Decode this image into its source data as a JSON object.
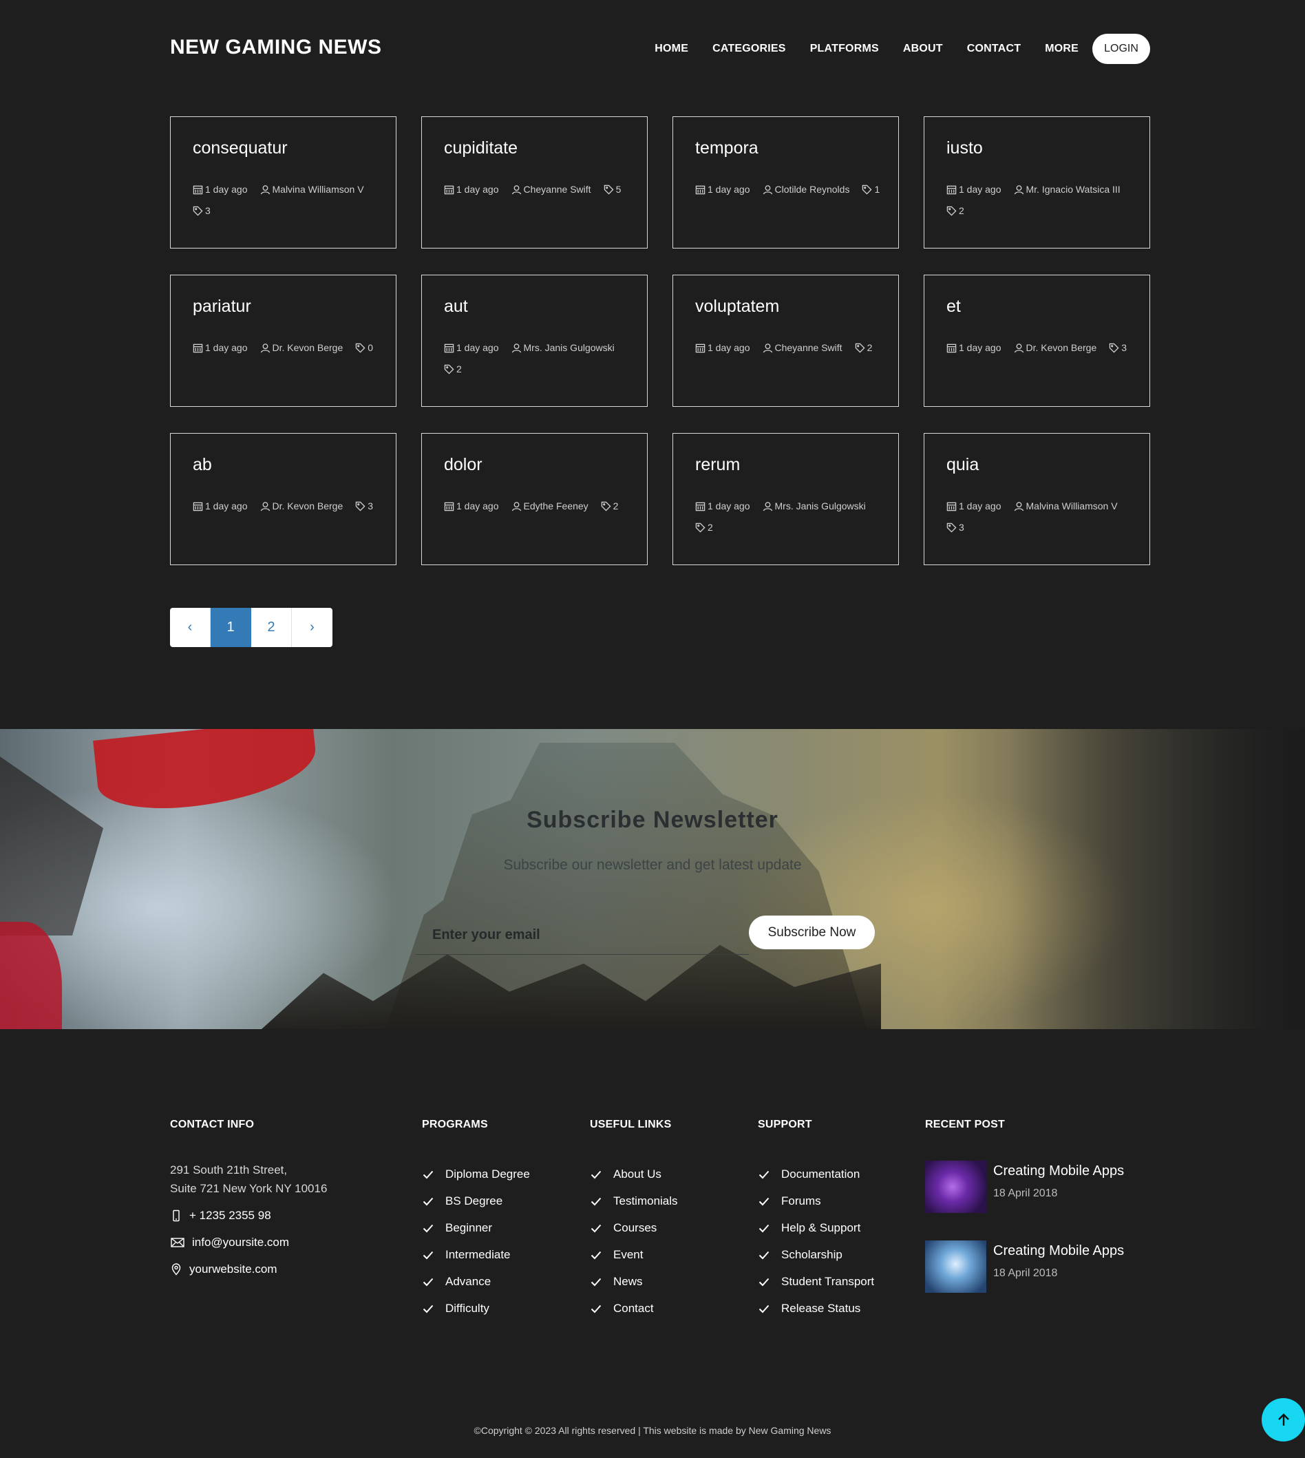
{
  "header": {
    "brand": "NEW GAMING NEWS",
    "nav": [
      "HOME",
      "CATEGORIES",
      "PLATFORMS",
      "ABOUT",
      "CONTACT",
      "MORE"
    ],
    "login": "LOGIN"
  },
  "posts": [
    {
      "title": "consequatur",
      "date": "1 day ago",
      "author": "Malvina Williamson V",
      "tags": "3"
    },
    {
      "title": "cupiditate",
      "date": "1 day ago",
      "author": "Cheyanne Swift",
      "tags": "5"
    },
    {
      "title": "tempora",
      "date": "1 day ago",
      "author": "Clotilde Reynolds",
      "tags": "1"
    },
    {
      "title": "iusto",
      "date": "1 day ago",
      "author": "Mr. Ignacio Watsica III",
      "tags": "2"
    },
    {
      "title": "pariatur",
      "date": "1 day ago",
      "author": "Dr. Kevon Berge",
      "tags": "0"
    },
    {
      "title": "aut",
      "date": "1 day ago",
      "author": "Mrs. Janis Gulgowski",
      "tags": "2"
    },
    {
      "title": "voluptatem",
      "date": "1 day ago",
      "author": "Cheyanne Swift",
      "tags": "2"
    },
    {
      "title": "et",
      "date": "1 day ago",
      "author": "Dr. Kevon Berge",
      "tags": "3"
    },
    {
      "title": "ab",
      "date": "1 day ago",
      "author": "Dr. Kevon Berge",
      "tags": "3"
    },
    {
      "title": "dolor",
      "date": "1 day ago",
      "author": "Edythe Feeney",
      "tags": "2"
    },
    {
      "title": "rerum",
      "date": "1 day ago",
      "author": "Mrs. Janis Gulgowski",
      "tags": "2"
    },
    {
      "title": "quia",
      "date": "1 day ago",
      "author": "Malvina Williamson V",
      "tags": "3"
    }
  ],
  "pagination": {
    "prev": "‹",
    "pages": [
      "1",
      "2"
    ],
    "active": "1",
    "next": "›"
  },
  "newsletter": {
    "title": "Subscribe Newsletter",
    "subtitle": "Subscribe our newsletter and get latest update",
    "placeholder": "Enter your email",
    "button": "Subscribe Now"
  },
  "footer": {
    "contact": {
      "heading": "CONTACT INFO",
      "address1": "291 South 21th Street,",
      "address2": "Suite 721 New York NY 10016",
      "phone": "+ 1235 2355 98",
      "email": "info@yoursite.com",
      "website": "yourwebsite.com"
    },
    "programs": {
      "heading": "PROGRAMS",
      "items": [
        "Diploma Degree",
        "BS Degree",
        "Beginner",
        "Intermediate",
        "Advance",
        "Difficulty"
      ]
    },
    "useful_links": {
      "heading": "USEFUL LINKS",
      "items": [
        "About Us",
        "Testimonials",
        "Courses",
        "Event",
        "News",
        "Contact"
      ]
    },
    "support": {
      "heading": "SUPPORT",
      "items": [
        "Documentation",
        "Forums",
        "Help & Support",
        "Scholarship",
        "Student Transport",
        "Release Status"
      ]
    },
    "recent_post": {
      "heading": "RECENT POST",
      "items": [
        {
          "title": "Creating Mobile Apps",
          "date": "18 April 2018"
        },
        {
          "title": "Creating Mobile Apps",
          "date": "18 April 2018"
        }
      ]
    },
    "copyright": "©Copyright © 2023 All rights reserved | This website is made by New Gaming News"
  },
  "colors": {
    "background": "#1e1e1e",
    "accent_blue": "#337ab7",
    "scroll_top": "#16d6f2"
  },
  "icons": [
    "calendar-icon",
    "user-icon",
    "tag-icon",
    "phone-icon",
    "mail-icon",
    "location-icon",
    "check-icon",
    "arrow-up-icon"
  ]
}
